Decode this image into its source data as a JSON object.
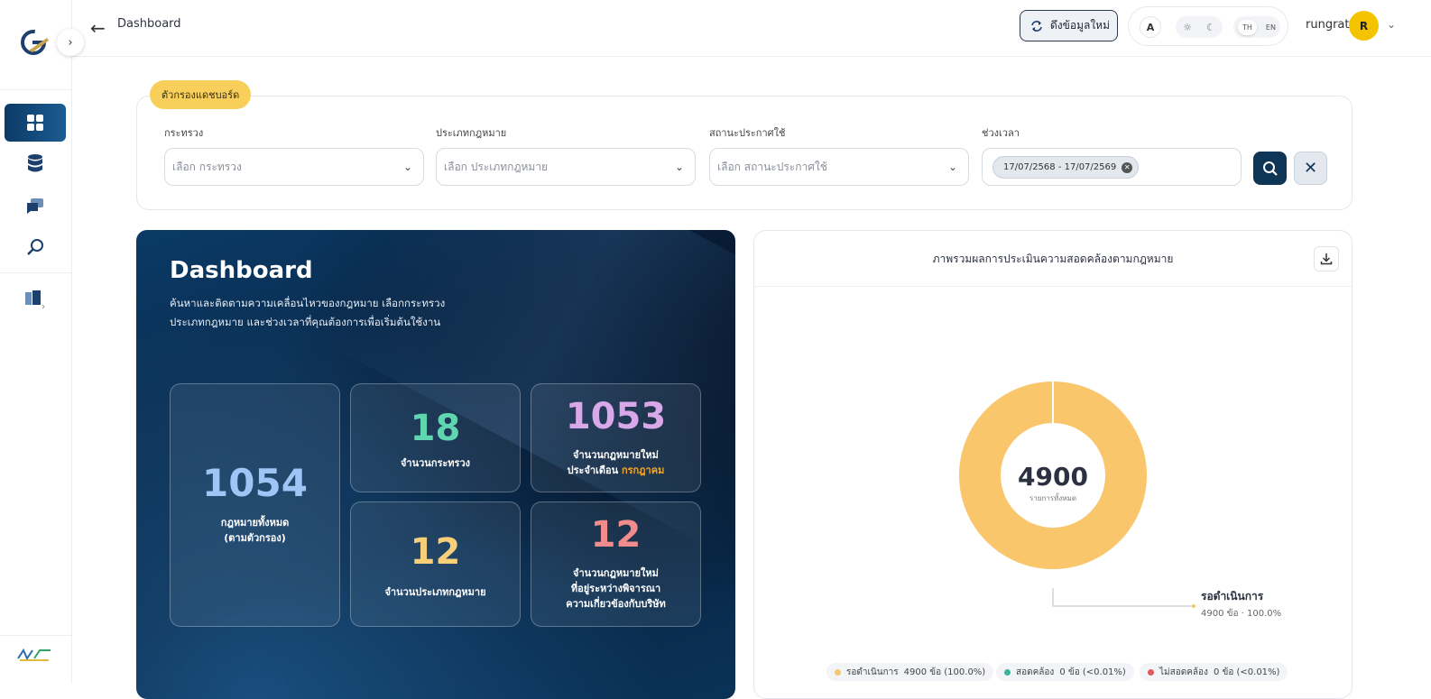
{
  "topbar": {
    "breadcrumb": "Dashboard",
    "refresh_label": "ดึงข้อมูลใหม่",
    "font_size_label": "A",
    "lang_th": "TH",
    "lang_en": "EN",
    "username": "rungrat",
    "avatar_initial": "R"
  },
  "filters": {
    "tag": "ตัวกรองแดชบอร์ด",
    "ministry_label": "กระทรวง",
    "ministry_placeholder": "เลือก กระทรวง",
    "law_type_label": "ประเภทกฎหมาย",
    "law_type_placeholder": "เลือก ประเภทกฎหมาย",
    "status_label": "สถานะประกาศใช้",
    "status_placeholder": "เลือก สถานะประกาศใช้",
    "period_label": "ช่วงเวลา",
    "period_value": "17/07/2568 - 17/07/2569"
  },
  "hero": {
    "title": "Dashboard",
    "description": "ค้นหาและติดตามความเคลื่อนไหวของกฎหมาย เลือกกระทรวง ประเภทกฎหมาย และช่วงเวลาที่คุณต้องการเพื่อเริ่มต้นใช้งาน",
    "stats": {
      "total": {
        "value": "1054",
        "label_line1": "กฎหมายทั้งหมด",
        "label_line2": "(ตามตัวกรอง)"
      },
      "ministries": {
        "value": "18",
        "label": "จำนวนกระทรวง"
      },
      "new_month": {
        "value": "1053",
        "label_line1": "จำนวนกฎหมายใหม่",
        "label_line2": "ประจำเดือน",
        "month": "กรกฎาคม"
      },
      "law_types": {
        "value": "12",
        "label": "จำนวนประเภทกฎหมาย"
      },
      "pending": {
        "value": "12",
        "label_line1": "จำนวนกฎหมายใหม่",
        "label_line2": "ที่อยู่ระหว่างพิจารณา",
        "label_line3": "ความเกี่ยวข้องกับบริษัท"
      }
    },
    "colors": {
      "total": "#9ec5f5",
      "ministries": "#5fd6b0",
      "new_month": "#d9a8e8",
      "law_types": "#f7cf7a",
      "pending": "#f28b8b",
      "highlight": "#f5a623"
    }
  },
  "chart_card": {
    "title": "ภาพรวมผลการประเมินความสอดคล้องตามกฎหมาย",
    "center_value": "4900",
    "center_label": "รายการทั้งหมด",
    "callout_name": "รอดำเนินการ",
    "callout_detail": "4900 ข้อ · 100.0%",
    "legend": [
      {
        "name": "รอดำเนินการ",
        "detail": "4900 ข้อ (100.0%)",
        "color": "#f9c66b"
      },
      {
        "name": "สอดคล้อง",
        "detail": "0 ข้อ (<0.01%)",
        "color": "#3bb59a"
      },
      {
        "name": "ไม่สอดคล้อง",
        "detail": "0 ข้อ (<0.01%)",
        "color": "#e05a5a"
      }
    ]
  },
  "chart_data": {
    "type": "pie",
    "categories": [
      "รอดำเนินการ",
      "สอดคล้อง",
      "ไม่สอดคล้อง"
    ],
    "values": [
      4900,
      0,
      0
    ],
    "colors": [
      "#f9c66b",
      "#3bb59a",
      "#e05a5a"
    ]
  }
}
